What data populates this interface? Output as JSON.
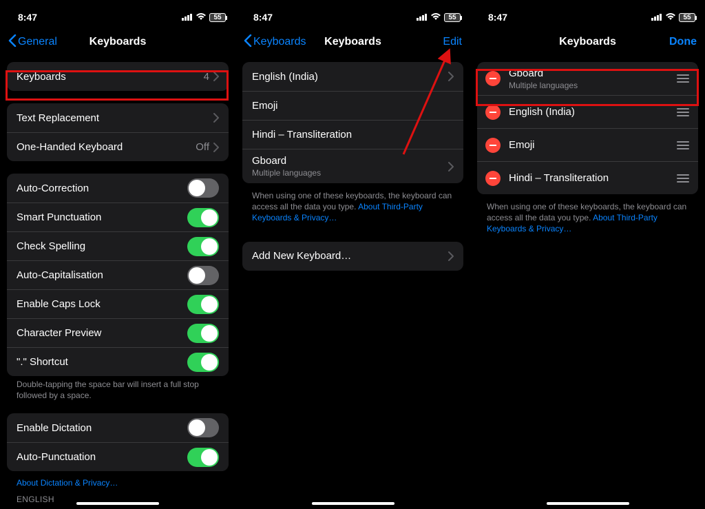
{
  "status": {
    "time": "8:47",
    "battery": "55"
  },
  "p1": {
    "back": "General",
    "title": "Keyboards",
    "keyboards_label": "Keyboards",
    "keyboards_count": "4",
    "text_replacement": "Text Replacement",
    "one_handed": "One-Handed Keyboard",
    "one_handed_value": "Off",
    "toggles": {
      "auto_correction": "Auto-Correction",
      "smart_punctuation": "Smart Punctuation",
      "check_spelling": "Check Spelling",
      "auto_cap": "Auto-Capitalisation",
      "caps_lock": "Enable Caps Lock",
      "char_preview": "Character Preview",
      "shortcut": "\".\" Shortcut"
    },
    "shortcut_hint": "Double-tapping the space bar will insert a full stop followed by a space.",
    "dictation": "Enable Dictation",
    "auto_punct": "Auto-Punctuation",
    "dictation_link": "About Dictation & Privacy…",
    "english_label": "ENGLISH"
  },
  "p2": {
    "back": "Keyboards",
    "title": "Keyboards",
    "edit": "Edit",
    "items": [
      {
        "label": "English (India)",
        "sub": "",
        "chev": true
      },
      {
        "label": "Emoji",
        "sub": "",
        "chev": false
      },
      {
        "label": "Hindi – Transliteration",
        "sub": "",
        "chev": false
      },
      {
        "label": "Gboard",
        "sub": "Multiple languages",
        "chev": true
      }
    ],
    "note_text": "When using one of these keyboards, the keyboard can access all the data you type. ",
    "note_link": "About Third-Party Keyboards & Privacy…",
    "add": "Add New Keyboard…"
  },
  "p3": {
    "title": "Keyboards",
    "done": "Done",
    "items": [
      {
        "label": "Gboard",
        "sub": "Multiple languages"
      },
      {
        "label": "English (India)",
        "sub": ""
      },
      {
        "label": "Emoji",
        "sub": ""
      },
      {
        "label": "Hindi – Transliteration",
        "sub": ""
      }
    ],
    "note_text": "When using one of these keyboards, the keyboard can access all the data you type. ",
    "note_link": "About Third-Party Keyboards & Privacy…"
  }
}
